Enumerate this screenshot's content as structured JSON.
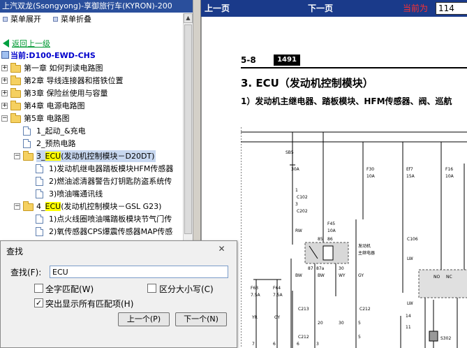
{
  "window": {
    "title": "上汽双龙(Ssongyong)-享御旅行车(KYRON)-200"
  },
  "menu": {
    "expand": "菜单展开",
    "collapse": "菜单折叠"
  },
  "nav": {
    "back": "返回上一级",
    "current": "当前:D100-EWD-CHS"
  },
  "tree": {
    "ch1": "第一章 如何判读电路图",
    "ch2": "第2章 导线连接器和搭铁位置",
    "ch3": "第3章 保险丝使用与容量",
    "ch4": "第4章 电源电路图",
    "ch5": "第5章 电路图",
    "i1": "1_起动_&充电",
    "i2": "2_预热电路",
    "i3_pre": "3_",
    "i3_hl": "ECU",
    "i3_post": "(发动机控制模块－D20DT)",
    "i3a": "1)发动机继电器踏板模块HFM传感器",
    "i3b": "2)燃油滤清器警告灯钥匙防盗系统传",
    "i3c": "3)喷油嘴通讯线",
    "i4_pre": "4_",
    "i4_hl": "ECU",
    "i4_post": "(发动机控制模块－GSL G23)",
    "i4a": "1)点火线圈喷油嘴踏板模块节气门传",
    "i4b": "2)氧传感器CPS爆震传感器MAP传感"
  },
  "toolbar": {
    "prev": "上一页",
    "next": "下一页",
    "current_label": "当前为",
    "page": "114"
  },
  "document": {
    "section": "5-8",
    "page_no": "1491",
    "heading": "3. ECU（发动机控制模块）",
    "subheading": "1）发动机主继电器、踏板模块、HFM传感器、阀、巡航",
    "relay_label1": "发动机",
    "relay_label2": "主继电器",
    "rails": [
      "30",
      "15"
    ],
    "fuses": [
      "SB5",
      "30A",
      "F30",
      "10A",
      "Ef7",
      "15A",
      "F16",
      "10A",
      "F45",
      "10A",
      "F63",
      "7.5A",
      "F64",
      "7.5A"
    ],
    "wires": [
      "RW",
      "BW",
      "BW",
      "WY",
      "YR",
      "GY",
      "GY",
      "LW",
      "LW"
    ],
    "connectors": [
      "C102",
      "C202",
      "C106",
      "C212",
      "C213",
      "C212",
      "S302"
    ],
    "pins": [
      "1",
      "3",
      "85",
      "86",
      "87",
      "87a",
      "30",
      "30",
      "20",
      "5",
      "5",
      "14",
      "11",
      "7",
      "6",
      "3",
      "6",
      "NO",
      "NC"
    ]
  },
  "find": {
    "title": "查找",
    "close": "✕",
    "find_label": "查找(F):",
    "find_value": "ECU",
    "whole_word": "全字匹配(W)",
    "match_case": "区分大小写(C)",
    "highlight_all": "突出显示所有匹配项(H)",
    "prev": "上一个(P)",
    "next": "下一个(N)",
    "check": "✓"
  }
}
